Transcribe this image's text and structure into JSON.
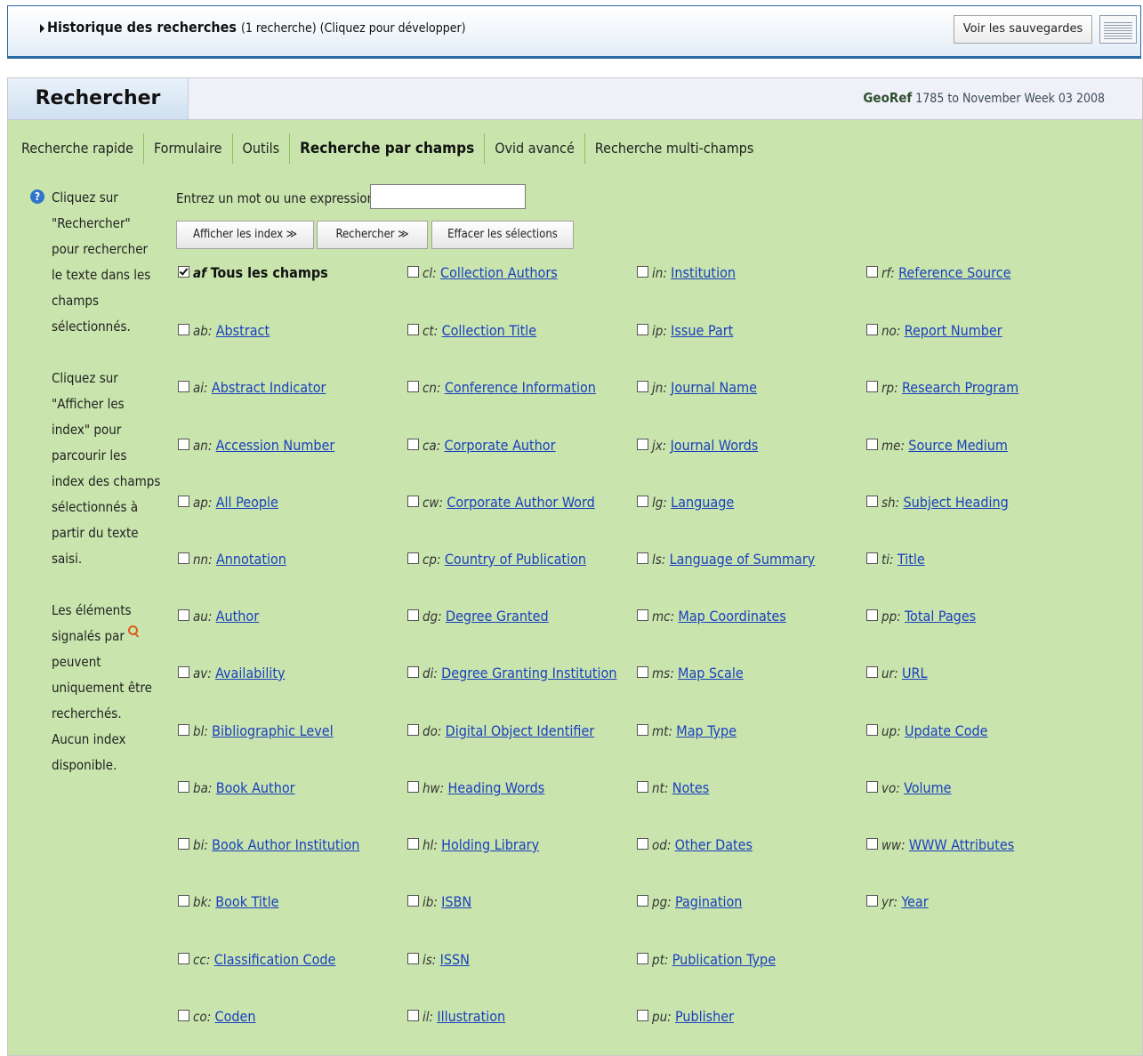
{
  "history": {
    "title": "Historique des recherches",
    "meta": "(1 recherche) (Cliquez pour développer)",
    "saved_button": "Voir les sauvegardes"
  },
  "panel": {
    "tab_title": "Rechercher",
    "db_name": "GeoRef",
    "db_range": "1785 to November Week 03 2008"
  },
  "tabs": [
    {
      "label": "Recherche rapide",
      "active": false
    },
    {
      "label": "Formulaire",
      "active": false
    },
    {
      "label": "Outils",
      "active": false
    },
    {
      "label": "Recherche par champs",
      "active": true
    },
    {
      "label": "Ovid avancé",
      "active": false
    },
    {
      "label": "Recherche multi-champs",
      "active": false
    }
  ],
  "help": [
    "Cliquez sur \"Rechercher\" pour rechercher le texte dans les champs sélectionnés.",
    "Cliquez sur \"Afficher les index\" pour parcourir les index des champs sélectionnés à partir du texte saisi.",
    "Les éléments signalés par",
    "peuvent uniquement être recherchés. Aucun index disponible."
  ],
  "search": {
    "label": "Entrez un mot ou une expression :",
    "value": "",
    "buttons": [
      "Afficher les index ≫",
      "Rechercher ≫",
      "Effacer les sélections"
    ]
  },
  "fields": [
    [
      {
        "code": "af",
        "name": "Tous les champs",
        "checked": true
      },
      {
        "code": "ab",
        "name": "Abstract"
      },
      {
        "code": "ai",
        "name": "Abstract Indicator"
      },
      {
        "code": "an",
        "name": "Accession Number"
      },
      {
        "code": "ap",
        "name": "All People"
      },
      {
        "code": "nn",
        "name": "Annotation"
      },
      {
        "code": "au",
        "name": "Author"
      },
      {
        "code": "av",
        "name": "Availability"
      },
      {
        "code": "bl",
        "name": "Bibliographic Level"
      },
      {
        "code": "ba",
        "name": "Book Author"
      },
      {
        "code": "bi",
        "name": "Book Author Institution"
      },
      {
        "code": "bk",
        "name": "Book Title"
      },
      {
        "code": "cc",
        "name": "Classification Code"
      },
      {
        "code": "co",
        "name": "Coden"
      }
    ],
    [
      {
        "code": "cl",
        "name": "Collection Authors"
      },
      {
        "code": "ct",
        "name": "Collection Title"
      },
      {
        "code": "cn",
        "name": "Conference Information"
      },
      {
        "code": "ca",
        "name": "Corporate Author"
      },
      {
        "code": "cw",
        "name": "Corporate Author Word"
      },
      {
        "code": "cp",
        "name": "Country of Publication"
      },
      {
        "code": "dg",
        "name": "Degree Granted"
      },
      {
        "code": "di",
        "name": "Degree Granting Institution"
      },
      {
        "code": "do",
        "name": "Digital Object Identifier"
      },
      {
        "code": "hw",
        "name": "Heading Words"
      },
      {
        "code": "hl",
        "name": "Holding Library"
      },
      {
        "code": "ib",
        "name": "ISBN"
      },
      {
        "code": "is",
        "name": "ISSN"
      },
      {
        "code": "il",
        "name": "Illustration"
      }
    ],
    [
      {
        "code": "in",
        "name": "Institution"
      },
      {
        "code": "ip",
        "name": "Issue Part"
      },
      {
        "code": "jn",
        "name": "Journal Name"
      },
      {
        "code": "jx",
        "name": "Journal Words"
      },
      {
        "code": "lg",
        "name": "Language"
      },
      {
        "code": "ls",
        "name": "Language of Summary"
      },
      {
        "code": "mc",
        "name": "Map Coordinates"
      },
      {
        "code": "ms",
        "name": "Map Scale"
      },
      {
        "code": "mt",
        "name": "Map Type"
      },
      {
        "code": "nt",
        "name": "Notes"
      },
      {
        "code": "od",
        "name": "Other Dates"
      },
      {
        "code": "pg",
        "name": "Pagination"
      },
      {
        "code": "pt",
        "name": "Publication Type"
      },
      {
        "code": "pu",
        "name": "Publisher"
      }
    ],
    [
      {
        "code": "rf",
        "name": "Reference Source"
      },
      {
        "code": "no",
        "name": "Report Number"
      },
      {
        "code": "rp",
        "name": "Research Program"
      },
      {
        "code": "me",
        "name": "Source Medium"
      },
      {
        "code": "sh",
        "name": "Subject Heading"
      },
      {
        "code": "ti",
        "name": "Title"
      },
      {
        "code": "pp",
        "name": "Total Pages"
      },
      {
        "code": "ur",
        "name": "URL"
      },
      {
        "code": "up",
        "name": "Update Code"
      },
      {
        "code": "vo",
        "name": "Volume"
      },
      {
        "code": "ww",
        "name": "WWW Attributes"
      },
      {
        "code": "yr",
        "name": "Year"
      }
    ]
  ]
}
